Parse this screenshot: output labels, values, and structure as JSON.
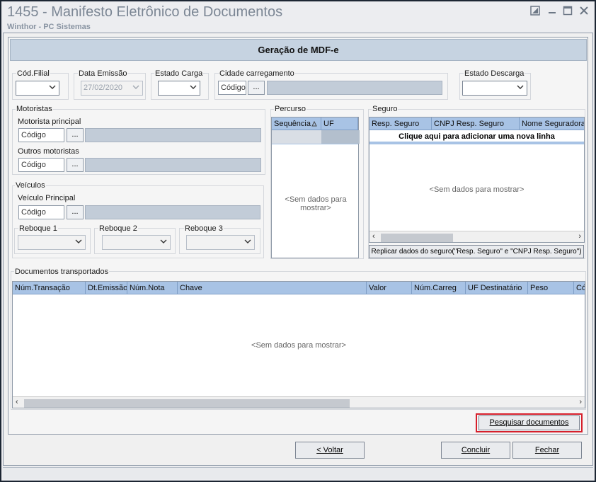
{
  "window": {
    "title": "1455 - Manifesto Eletrônico de Documentos",
    "subtitle": "Winthor - PC Sistemas"
  },
  "header": {
    "title": "Geração de MDF-e"
  },
  "fields": {
    "cod_filial_label": "Cód.Filial",
    "data_emissao_label": "Data Emissão",
    "data_emissao_value": "27/02/2020",
    "estado_carga_label": "Estado Carga",
    "cidade_carregamento_label": "Cidade carregamento",
    "codigo_placeholder": "Código",
    "ellipsis": "...",
    "estado_descarga_label": "Estado Descarga"
  },
  "motoristas": {
    "group_label": "Motoristas",
    "principal_label": "Motorista principal",
    "outros_label": "Outros motoristas"
  },
  "veiculos": {
    "group_label": "Veículos",
    "principal_label": "Veículo Principal",
    "reboque1": "Reboque 1",
    "reboque2": "Reboque 2",
    "reboque3": "Reboque 3"
  },
  "percurso": {
    "group_label": "Percurso",
    "columns": [
      "Sequência",
      "UF"
    ],
    "empty": "<Sem dados para mostrar>"
  },
  "seguro": {
    "group_label": "Seguro",
    "columns": [
      "Resp. Seguro",
      "CNPJ Resp. Seguro",
      "Nome Seguradora"
    ],
    "add_row": "Clique aqui para adicionar uma nova linha",
    "empty": "<Sem dados para mostrar>",
    "replicar_button": "Replicar dados do seguro(\"Resp. Seguro\" e \"CNPJ Resp. Seguro\")"
  },
  "documentos": {
    "group_label": "Documentos transportados",
    "columns": [
      "Núm.Transação",
      "Dt.Emissão",
      "Núm.Nota",
      "Chave",
      "Valor",
      "Núm.Carreg",
      "UF Destinatário",
      "Peso",
      "Có"
    ],
    "empty": "<Sem dados para mostrar>"
  },
  "buttons": {
    "pesquisar": "Pesquisar documentos",
    "voltar": "< Voltar",
    "concluir": "Concluir",
    "fechar": "Fechar"
  },
  "colors": {
    "grid_header": "#a8c3e5",
    "highlight_border": "#d61f2b",
    "header_band": "#c6d3e1"
  }
}
